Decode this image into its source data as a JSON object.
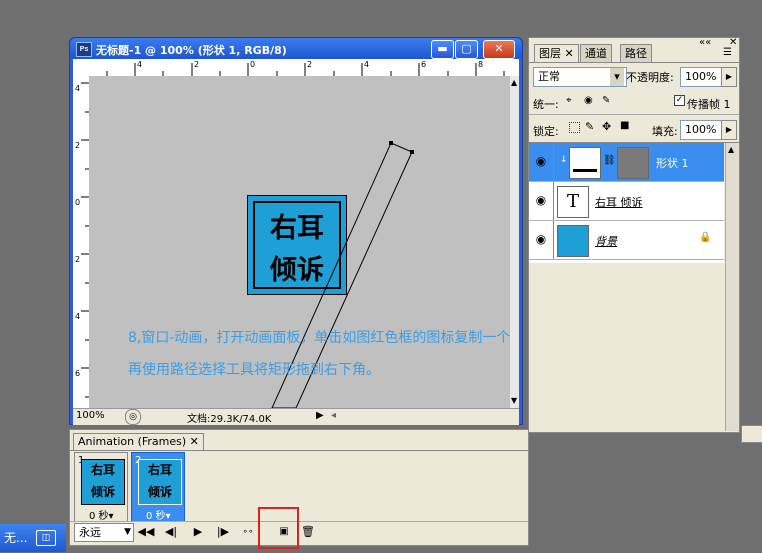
{
  "document": {
    "title": "无标题-1 @ 100% (形状 1, RGB/8)",
    "zoom": "100%",
    "doc_info": "文档:29.3K/74.0K",
    "ruler_top_labels": [
      "4",
      "2",
      "0",
      "2",
      "4",
      "6",
      "8"
    ],
    "ruler_left_labels": [
      "4",
      "2",
      "0",
      "2",
      "4",
      "6"
    ],
    "logo_line1": "右耳",
    "logo_line2": "倾诉"
  },
  "instruction": {
    "line1": "8,窗口-动画，打开动画面板，单击如图红色框的图标复制一个",
    "line2": "再使用路径选择工具将矩形拖到右下角。"
  },
  "layers_panel": {
    "tabs": [
      "图层",
      "通道",
      "路径"
    ],
    "blend_mode": "正常",
    "opacity_label": "不透明度:",
    "opacity_value": "100%",
    "unify_label": "统一:",
    "propagate_label": "传播帧 1",
    "lock_label": "锁定:",
    "fill_label": "填充:",
    "fill_value": "100%",
    "layers": [
      {
        "name": "形状 1",
        "selected": true
      },
      {
        "name": "右耳 倾诉",
        "type_symbol": "T"
      },
      {
        "name": "背景",
        "lock_symbol": "🔒"
      }
    ]
  },
  "animation_panel": {
    "tab_label": "Animation (Frames)",
    "frames": [
      {
        "number": "1",
        "delay": "0 秒▾",
        "line1": "右耳",
        "line2": "倾诉"
      },
      {
        "number": "2",
        "delay": "0 秒▾",
        "line1": "右耳",
        "line2": "倾诉"
      }
    ],
    "loop_label": "永远"
  },
  "taskbar": {
    "item_label": "无..."
  },
  "colors": {
    "logo_blue": "#1e9fd6",
    "selection_blue": "#3a8ef0",
    "instruction_text": "#3a9ee8",
    "highlight_red": "#e02020"
  }
}
